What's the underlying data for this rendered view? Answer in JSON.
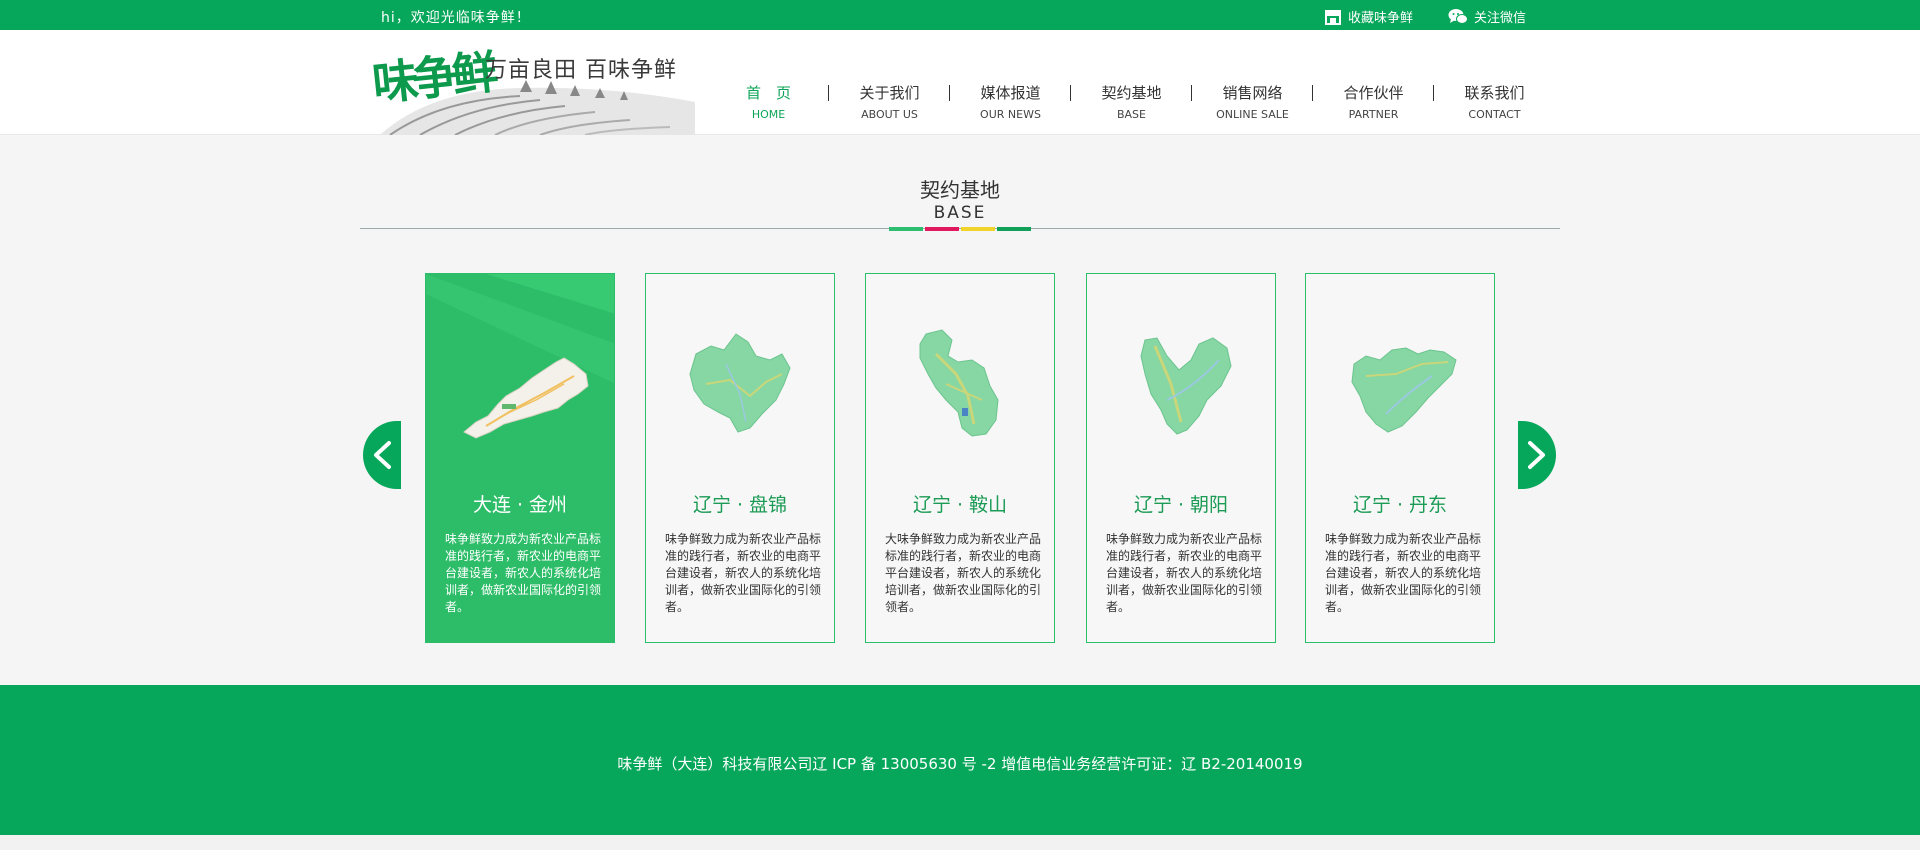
{
  "topbar": {
    "greeting": "hi，欢迎光临味争鲜！",
    "favorite_label": "收藏味争鲜",
    "wechat_label": "关注微信"
  },
  "logo": {
    "brand": "味争鲜",
    "slogan": "万亩良田 百味争鲜"
  },
  "nav": [
    {
      "cn": "首　页",
      "en": "HOME",
      "active": true
    },
    {
      "cn": "关于我们",
      "en": "ABOUT US"
    },
    {
      "cn": "媒体报道",
      "en": "OUR NEWS"
    },
    {
      "cn": "契约基地",
      "en": "BASE"
    },
    {
      "cn": "销售网络",
      "en": "ONLINE SALE"
    },
    {
      "cn": "合作伙伴",
      "en": "PARTNER"
    },
    {
      "cn": "联系我们",
      "en": "CONTACT"
    }
  ],
  "section": {
    "title_cn": "契约基地",
    "title_en": "BASE",
    "bar_colors": [
      "#2cbd6e",
      "#e0185e",
      "#f2d32a",
      "#11a05a"
    ]
  },
  "cards": [
    {
      "city": "大连 · 金州",
      "desc": "味争鲜致力成为新农业产品标准的践行者，新农业的电商平台建设者，新农人的系统化培训者，做新农业国际化的引领者。",
      "active": true
    },
    {
      "city": "辽宁 · 盘锦",
      "desc": "味争鲜致力成为新农业产品标准的践行者，新农业的电商平台建设者，新农人的系统化培训者，做新农业国际化的引领者。"
    },
    {
      "city": "辽宁 · 鞍山",
      "desc": "大味争鲜致力成为新农业产品标准的践行者，新农业的电商平台建设者，新农人的系统化培训者，做新农业国际化的引领者。"
    },
    {
      "city": "辽宁 · 朝阳",
      "desc": "味争鲜致力成为新农业产品标准的践行者，新农业的电商平台建设者，新农人的系统化培训者，做新农业国际化的引领者。"
    },
    {
      "city": "辽宁 · 丹东",
      "desc": "味争鲜致力成为新农业产品标准的践行者，新农业的电商平台建设者，新农人的系统化培训者，做新农业国际化的引领者。"
    }
  ],
  "footer": {
    "copyright": "味争鲜（大连）科技有限公司辽 ICP 备 13005630 号 -2 增值电信业务经营许可证：辽 B2-20140019"
  },
  "colors": {
    "brand_green": "#06a75a",
    "card_active": "#2dbd68",
    "map_green": "#86d7a3"
  }
}
